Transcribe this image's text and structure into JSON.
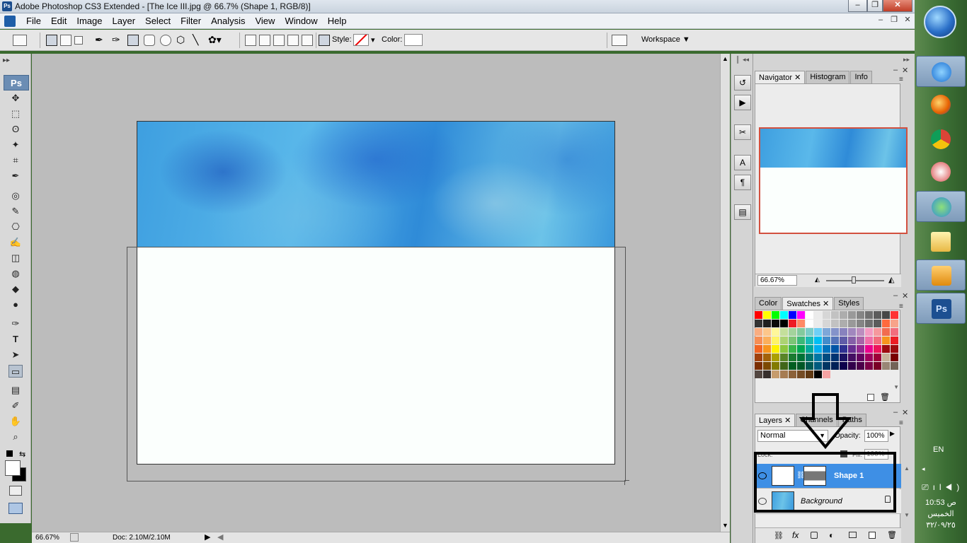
{
  "window": {
    "title": "Adobe Photoshop CS3 Extended - [The Ice III.jpg @ 66.7% (Shape 1, RGB/8)]",
    "app_badge": "Ps",
    "controls": [
      "‒",
      "❐",
      "✕"
    ]
  },
  "menu": {
    "items": [
      "File",
      "Edit",
      "Image",
      "Layer",
      "Select",
      "Filter",
      "Analysis",
      "View",
      "Window",
      "Help"
    ]
  },
  "options": {
    "style_label": "Style:",
    "color_label": "Color:",
    "workspace_label": "Workspace ▼"
  },
  "toolbox": {
    "logo": "Ps",
    "tools": [
      "✥",
      "⬚",
      "ʘ",
      "✦",
      "⌗",
      "✒",
      "◎",
      "✎",
      "⎔",
      "✍",
      "◫",
      "◍",
      "◆",
      "●",
      "✑",
      "T",
      "➤",
      "▭",
      "▤",
      "✐",
      "✋",
      "⌕"
    ]
  },
  "status": {
    "zoom": "66.67%",
    "doc": "Doc: 2.10M/2.10M"
  },
  "navigator": {
    "tabs": [
      "Navigator",
      "Histogram",
      "Info"
    ],
    "zoom": "66.67%"
  },
  "color_panel": {
    "tabs": [
      "Color",
      "Swatches",
      "Styles"
    ]
  },
  "layers_panel": {
    "tabs": [
      "Layers",
      "Channels",
      "Paths"
    ],
    "blend_mode": "Normal",
    "opacity_label": "Opacity:",
    "opacity": "100%",
    "fill_label": "Fill:",
    "fill": "100%",
    "lock_label": "Lock:",
    "layers": [
      {
        "name": "Shape 1",
        "selected": true
      },
      {
        "name": "Background",
        "selected": false
      }
    ]
  },
  "taskbar": {
    "lang": "EN",
    "time": "10:53 ص",
    "day": "الخميس",
    "date": "٣٢/٠٩/٢٥"
  },
  "swatch_colors": [
    "#ff0000",
    "#ffff00",
    "#00ff00",
    "#00ffff",
    "#0000ff",
    "#ff00ff",
    "#ffffff",
    "#ebebeb",
    "#d6d6d6",
    "#c2c2c2",
    "#adadad",
    "#999999",
    "#858585",
    "#707070",
    "#5c5c5c",
    "#474747",
    "#ff3333",
    "#333333",
    "#1f1f1f",
    "#0a0a0a",
    "#000000",
    "#ed1c24",
    "#ff8a66",
    "#ffffff",
    "#ebebeb",
    "#d6d6d6",
    "#c2c2c2",
    "#adadad",
    "#999999",
    "#858585",
    "#707070",
    "#5c5c5c",
    "#ff6a3d",
    "#f7a38a",
    "#f9ad81",
    "#fdc68a",
    "#fff79a",
    "#c4df9b",
    "#a3d39c",
    "#82ca9d",
    "#7bcdc8",
    "#6ecff6",
    "#7ea7d8",
    "#8493ca",
    "#8882be",
    "#a187be",
    "#bc8dbf",
    "#f49ac2",
    "#f6989d",
    "#f26c4f",
    "#f26d7d",
    "#f68e55",
    "#fbaf5c",
    "#fff467",
    "#acd372",
    "#7cc576",
    "#3bb878",
    "#1abbb4",
    "#00bff3",
    "#438ccb",
    "#5574b9",
    "#605ca8",
    "#855fa8",
    "#a763a8",
    "#f06ea9",
    "#f26d7d",
    "#f7941d",
    "#ed1c24",
    "#f26522",
    "#f7941d",
    "#fff200",
    "#8dc63f",
    "#39b54a",
    "#00a651",
    "#00a99d",
    "#00aeef",
    "#0072bc",
    "#0054a6",
    "#2e3192",
    "#662d91",
    "#92278f",
    "#ec008c",
    "#ed145b",
    "#9e0b0f",
    "#9e0b0f",
    "#a0410d",
    "#a36209",
    "#aba000",
    "#598527",
    "#1a7b30",
    "#007236",
    "#00746b",
    "#0076a3",
    "#004b80",
    "#003471",
    "#1b1464",
    "#440e62",
    "#630460",
    "#9e005d",
    "#9e0039",
    "#c7b299",
    "#790000",
    "#7b2e00",
    "#7d4900",
    "#827b00",
    "#406618",
    "#005e20",
    "#005826",
    "#005952",
    "#005b7f",
    "#003663",
    "#002157",
    "#0d004c",
    "#32004b",
    "#4b0049",
    "#7b0046",
    "#7a0026",
    "#998675",
    "#736357",
    "#534741",
    "#37302d",
    "#c69c6d",
    "#a67c52",
    "#8c6239",
    "#754c24",
    "#603913",
    "#000000",
    "#f5a3a3"
  ]
}
